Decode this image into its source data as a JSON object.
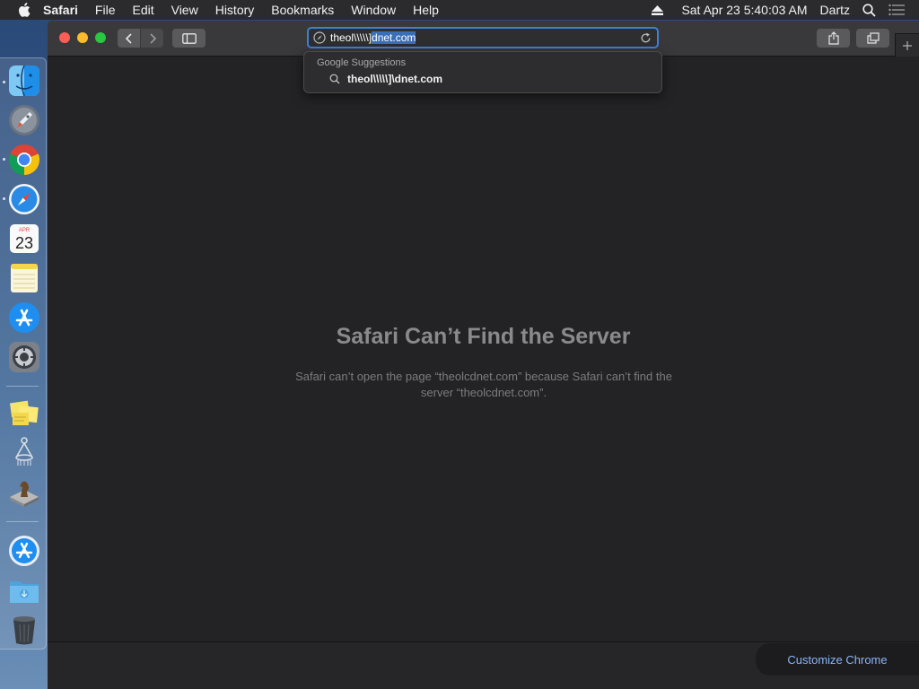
{
  "menubar": {
    "apple_icon": "apple-logo-icon",
    "app_name": "Safari",
    "items": [
      "File",
      "Edit",
      "View",
      "History",
      "Bookmarks",
      "Window",
      "Help"
    ],
    "datetime": "Sat Apr 23  5:40:03 AM",
    "user": "Dartz",
    "icons": [
      "eject-icon",
      "spotlight-search-icon",
      "notification-list-icon"
    ]
  },
  "dock": {
    "items": [
      "finder-icon",
      "launchpad-icon",
      "chrome-icon",
      "safari-icon",
      "calendar-icon",
      "notes-icon",
      "app-store-icon",
      "system-preferences-icon",
      "stickies-icon",
      "hoops-icon",
      "chess-icon",
      "app-store-downloads-icon",
      "downloads-folder-icon",
      "trash-icon"
    ],
    "calendar": {
      "month": "APR",
      "day": "23"
    }
  },
  "toolbar": {
    "address_value_pre": "theol\\\\\\\\\\]",
    "address_value_post": "dnet.com",
    "icons": [
      "back-icon",
      "forward-icon",
      "sidebar-icon",
      "compass-icon",
      "reload-icon",
      "share-icon",
      "tabs-overview-icon",
      "new-tab-icon"
    ]
  },
  "suggestions": {
    "header": "Google Suggestions",
    "item": "theol\\\\\\\\\\]\\dnet.com"
  },
  "error": {
    "title": "Safari Can’t Find the Server",
    "message": "Safari can’t open the page “theolcdnet.com” because Safari can’t find the server “theolcdnet.com”."
  },
  "customize_chrome": "Customize Chrome",
  "colors": {
    "accent": "#3f7fd8",
    "link": "#8ab4f8",
    "close": "#fd5f57",
    "minimize": "#fdbc2e",
    "zoom": "#28c840"
  }
}
